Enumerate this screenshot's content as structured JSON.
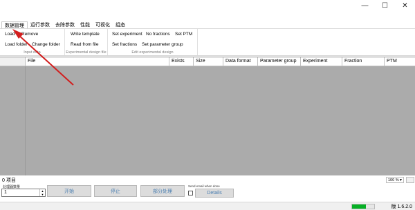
{
  "window_controls": {
    "minimize": "—",
    "maximize": "☐",
    "close": "✕"
  },
  "tabs": [
    {
      "label": "数据管理",
      "active": true
    },
    {
      "label": "运行参数"
    },
    {
      "label": "去除参数"
    },
    {
      "label": "性能"
    },
    {
      "label": "可视化"
    },
    {
      "label": "组态"
    }
  ],
  "ribbon": {
    "input_data": {
      "label": "Input data",
      "load": "Load",
      "remove": "Remove",
      "load_folder": "Load folder",
      "change_folder": "Change folder"
    },
    "design_file": {
      "label": "Experimental design file",
      "write_template": "Write template",
      "read_from_file": "Read from file"
    },
    "edit_design": {
      "label": "Edit experimental design",
      "set_experiment": "Set experiment",
      "no_fractions": "No fractions",
      "set_ptm": "Set PTM",
      "set_fractions": "Set fractions",
      "set_parameter_group": "Set parameter group"
    }
  },
  "table": {
    "columns": [
      "File",
      "Exists",
      "Size",
      "Data format",
      "Parameter group",
      "Experiment",
      "Fraction",
      "PTM"
    ]
  },
  "status": {
    "count": "0 项目",
    "zoom": "100 %"
  },
  "controls": {
    "processors_label": "处理器数量",
    "processors_value": "1",
    "start": "开始",
    "stop": "停止",
    "partial": "部分处理",
    "email_label": "Send email when done",
    "details": "Details"
  },
  "footer": {
    "progress": 0.62,
    "version": "版 1.6.2.0"
  }
}
